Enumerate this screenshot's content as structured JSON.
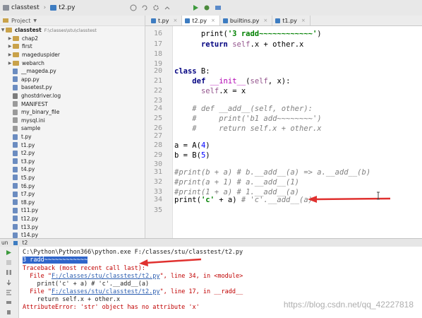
{
  "breadcrumb": {
    "project": "classtest",
    "file": "t2.py"
  },
  "sidebar": {
    "header": "Project",
    "root": {
      "label": "classtest",
      "path": "F:\\classes\\stu\\classtest"
    },
    "items": [
      {
        "label": "chap2",
        "kind": "folder"
      },
      {
        "label": "first",
        "kind": "folder"
      },
      {
        "label": "mageduspider",
        "kind": "folder"
      },
      {
        "label": "webarch",
        "kind": "folder"
      },
      {
        "label": "__mageda.py",
        "kind": "py"
      },
      {
        "label": "app.py",
        "kind": "py"
      },
      {
        "label": "basetest.py",
        "kind": "py"
      },
      {
        "label": "ghostdriver.log",
        "kind": "log"
      },
      {
        "label": "MANIFEST",
        "kind": "txt"
      },
      {
        "label": "my_binary_file",
        "kind": "txt"
      },
      {
        "label": "mysql.ini",
        "kind": "txt"
      },
      {
        "label": "sample",
        "kind": "txt"
      },
      {
        "label": "t.py",
        "kind": "py"
      },
      {
        "label": "t1.py",
        "kind": "py"
      },
      {
        "label": "t2.py",
        "kind": "py"
      },
      {
        "label": "t3.py",
        "kind": "py"
      },
      {
        "label": "t4.py",
        "kind": "py"
      },
      {
        "label": "t5.py",
        "kind": "py"
      },
      {
        "label": "t6.py",
        "kind": "py"
      },
      {
        "label": "t7.py",
        "kind": "py"
      },
      {
        "label": "t8.py",
        "kind": "py"
      },
      {
        "label": "t11.py",
        "kind": "py"
      },
      {
        "label": "t12.py",
        "kind": "py"
      },
      {
        "label": "t13.py",
        "kind": "py"
      },
      {
        "label": "t14.py",
        "kind": "py"
      }
    ]
  },
  "tabs": [
    {
      "label": "t.py",
      "active": false
    },
    {
      "label": "t2.py",
      "active": true
    },
    {
      "label": "builtins.py",
      "active": false
    },
    {
      "label": "t1.py",
      "active": false
    }
  ],
  "editor": {
    "line_numbers": [
      "16",
      "17",
      "18",
      "19",
      "20",
      "21",
      "22",
      "23",
      "24",
      "25",
      "26",
      "27",
      "28",
      "29",
      "30",
      "31",
      "32",
      "33",
      "34",
      "35"
    ],
    "current_line": "34"
  },
  "run": {
    "tab_label": "un",
    "config": "t2",
    "lines": {
      "cmd": "C:\\Python\\Python366\\python.exe F:/classes/stu/classtest/t2.py",
      "out1": "3 radd~~~~~~~~~~~~",
      "tb": "Traceback (most recent call last):",
      "f1a": "  File \"",
      "f1link": "F:/classes/stu/classtest/t2.py",
      "f1b": "\", line 34, in <module>",
      "f1code": "    print('c' + a) # 'c'.__add__(a)",
      "f2a": "  File \"",
      "f2link": "F:/classes/stu/classtest/t2.py",
      "f2b": "\", line 17, in __radd__",
      "f2code": "    return self.x + other.x",
      "err": "AttributeError: 'str' object has no attribute 'x'"
    }
  },
  "watermark": "https://blog.csdn.net/qq_42227818",
  "colors": {
    "keyword": "#000080",
    "string": "#008000",
    "comment": "#808080",
    "arrow": "#e0312f",
    "selection": "#2f65ca"
  }
}
